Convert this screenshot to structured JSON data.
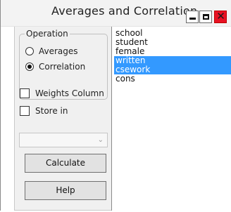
{
  "window": {
    "title": "Averages and Correlation",
    "close_glyph": "✕"
  },
  "operation": {
    "group_label": "Operation",
    "options": [
      {
        "label": "Averages",
        "checked": false
      },
      {
        "label": "Correlation",
        "checked": true
      }
    ]
  },
  "checkboxes": {
    "weights_label": "Weights Column",
    "store_label": "Store in"
  },
  "combo": {
    "value": "",
    "arrow": "⌄"
  },
  "buttons": {
    "calculate": "Calculate",
    "help": "Help"
  },
  "variables": {
    "items": [
      {
        "label": "school",
        "selected": false
      },
      {
        "label": "student",
        "selected": false
      },
      {
        "label": "female",
        "selected": false
      },
      {
        "label": "written",
        "selected": true
      },
      {
        "label": "csework",
        "selected": true
      },
      {
        "label": "cons",
        "selected": false
      }
    ]
  },
  "colors": {
    "selection": "#3399ff",
    "close_button": "#e81123",
    "panel": "#f0f0f0"
  }
}
